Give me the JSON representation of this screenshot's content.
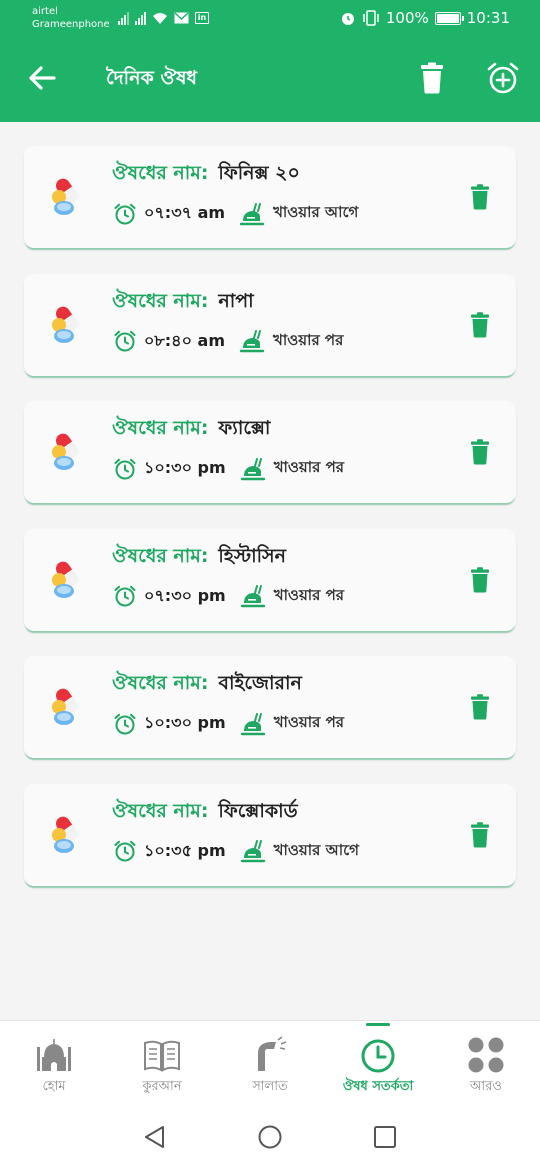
{
  "status_bar": {
    "carrier1": "airtel",
    "carrier2": "Grameenphone",
    "battery": "100%",
    "time": "10:31"
  },
  "app_bar": {
    "title": "দৈনিক ঔষধ"
  },
  "name_label": "ঔষধের নাম:",
  "medicines": [
    {
      "name": "ফিনিক্স ২০",
      "time": "০৭:৩৭ am",
      "meal": "খাওয়ার আগে"
    },
    {
      "name": "নাপা",
      "time": "০৮:৪০ am",
      "meal": "খাওয়ার পর"
    },
    {
      "name": "ফ্যাক্সো",
      "time": "১০:৩০ pm",
      "meal": "খাওয়ার পর"
    },
    {
      "name": "হিস্টাসিন",
      "time": "০৭:৩০ pm",
      "meal": "খাওয়ার পর"
    },
    {
      "name": "বাইজোরান",
      "time": "১০:৩০ pm",
      "meal": "খাওয়ার পর"
    },
    {
      "name": "ফিক্সোকার্ড",
      "time": "১০:৩৫ pm",
      "meal": "খাওয়ার আগে"
    }
  ],
  "bottom_nav": [
    {
      "label": "হোম",
      "icon": "mosque-icon"
    },
    {
      "label": "কুরআন",
      "icon": "quran-icon"
    },
    {
      "label": "সালাত",
      "icon": "prayer-icon"
    },
    {
      "label": "ঔষধ সতর্কতা",
      "icon": "alarm-icon",
      "active": true
    },
    {
      "label": "আরও",
      "icon": "more-icon"
    }
  ],
  "colors": {
    "primary": "#1fb36a",
    "accent_text": "#1fa862"
  }
}
